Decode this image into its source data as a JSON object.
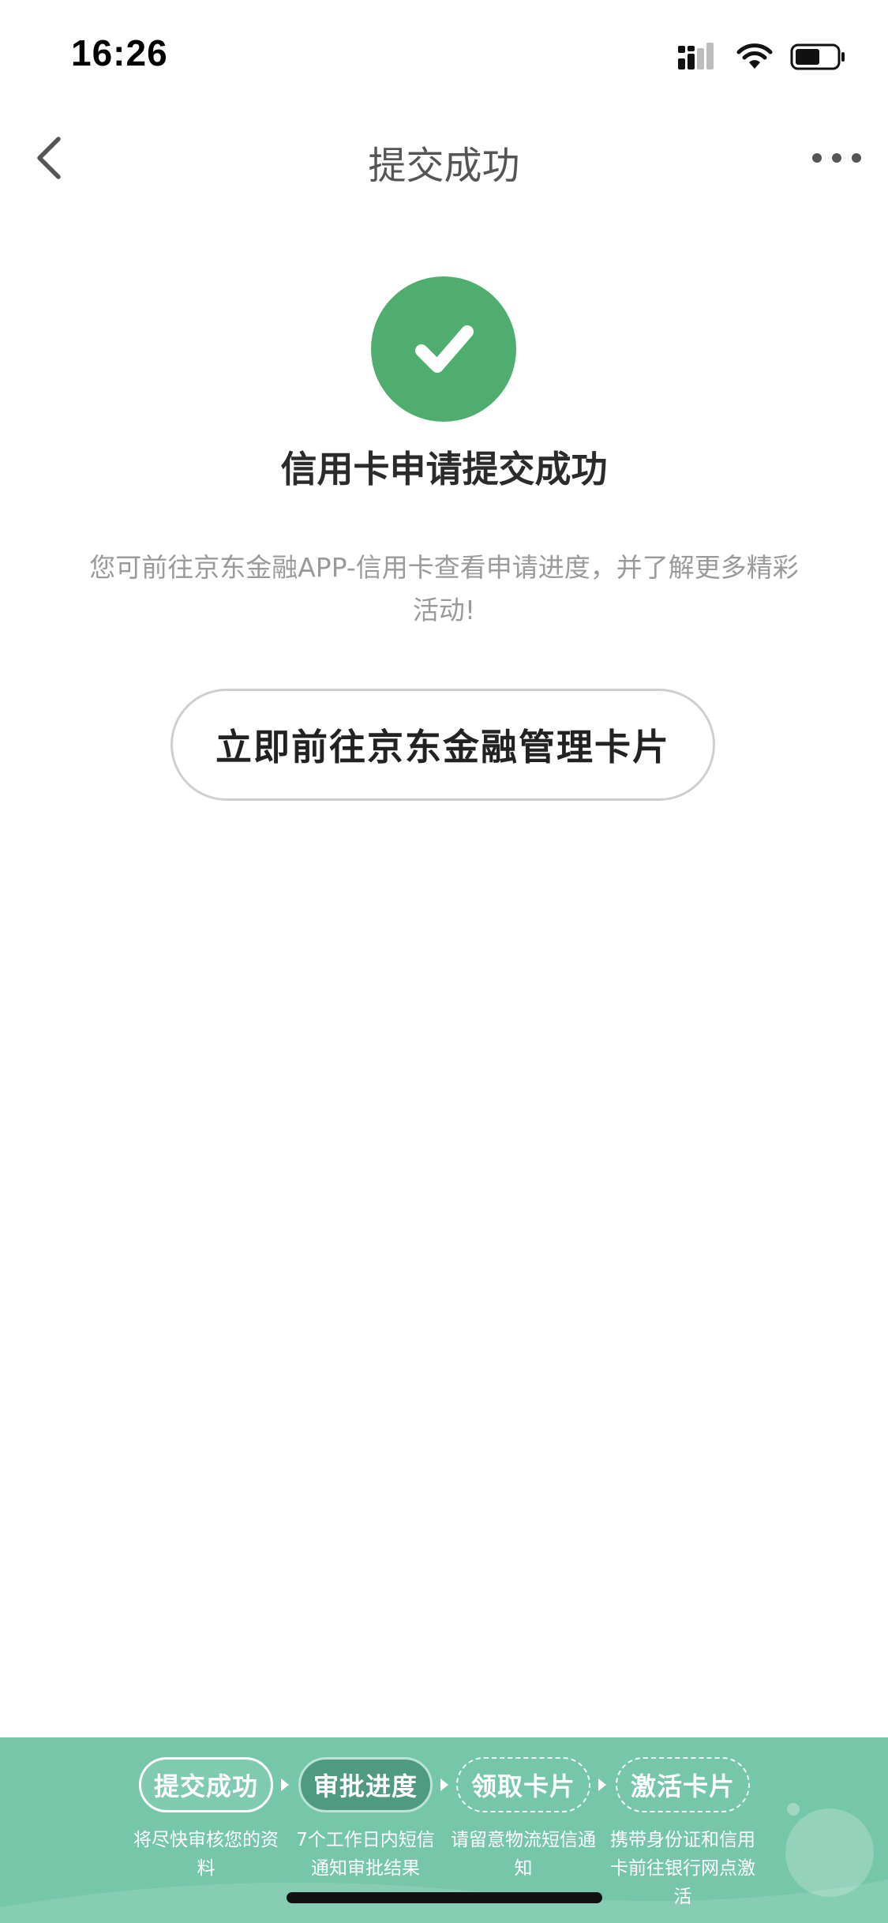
{
  "status_bar": {
    "time": "16:26",
    "icons": [
      "signal-icon",
      "wifi-icon",
      "battery-icon"
    ]
  },
  "nav": {
    "title": "提交成功",
    "back_icon": "chevron-left-icon",
    "more_icon": "more-dots-icon"
  },
  "success": {
    "icon": "checkmark-circle-icon",
    "title": "信用卡申请提交成功",
    "description": "您可前往京东金融APP-信用卡查看申请进度，并了解更多精彩活动!",
    "cta_label": "立即前往京东金融管理卡片"
  },
  "progress": {
    "steps": [
      {
        "label": "提交成功",
        "desc": "将尽快审核您的资料",
        "state": "done"
      },
      {
        "label": "审批进度",
        "desc": "7个工作日内短信通知审批结果",
        "state": "current"
      },
      {
        "label": "领取卡片",
        "desc": "请留意物流短信通知",
        "state": "future"
      },
      {
        "label": "激活卡片",
        "desc": "携带身份证和信用卡前往银行网点激活",
        "state": "future"
      }
    ]
  },
  "colors": {
    "success_green": "#4fae6f",
    "banner_green": "#76c6aa",
    "current_step": "#4f9a80"
  }
}
